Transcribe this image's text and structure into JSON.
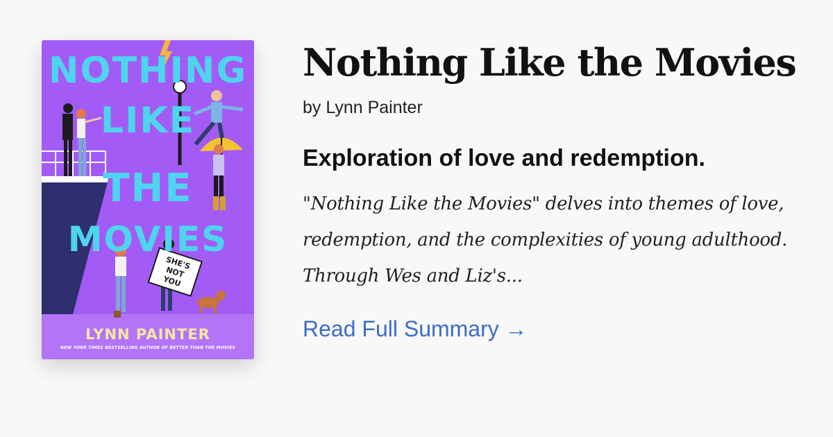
{
  "book": {
    "title": "Nothing Like the Movies",
    "byline": "by Lynn Painter",
    "tagline": "Exploration of love and redemption.",
    "summary": "\"Nothing Like the Movies\" delves into themes of love, redemption, and the complexities of young adulthood. Through Wes and Liz's...",
    "read_more": "Read Full Summary →"
  },
  "cover": {
    "title_lines": [
      "NOTHING",
      "LIKE",
      "THE",
      "MOVIES"
    ],
    "sign_text": [
      "SHE'S",
      "NOT",
      "YOU"
    ],
    "author": "LYNN PAINTER",
    "tagline": "NEW YORK TIMES BESTSELLING AUTHOR OF BETTER THAN THE MOVIES",
    "colors": {
      "background": "#a35bf6",
      "title": "#4fd4ee",
      "author": "#f6e7a3"
    }
  },
  "colors": {
    "page_background": "#f8f8f8",
    "link": "#3d6cc7"
  }
}
